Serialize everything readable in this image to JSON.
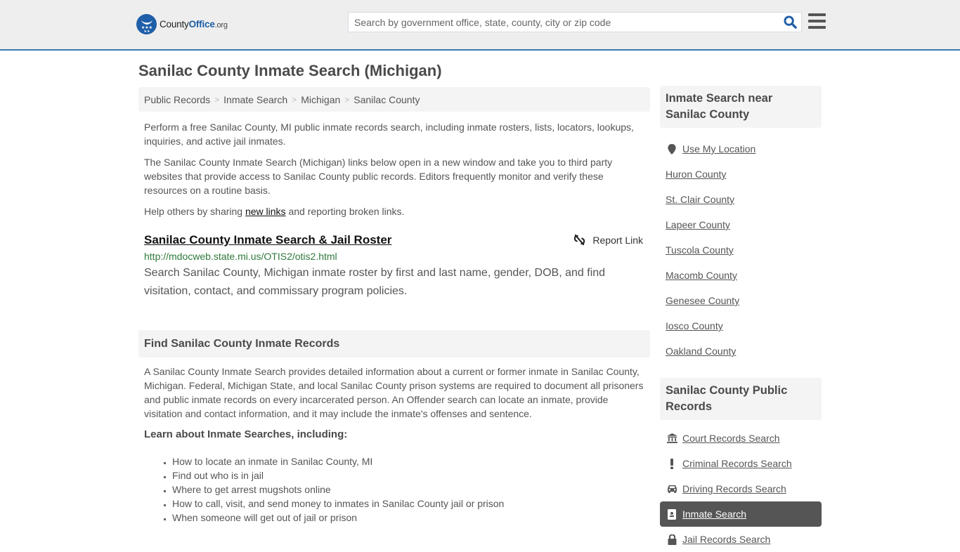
{
  "header": {
    "logo": {
      "part1": "County",
      "part2": "Office",
      "part3": ".org"
    },
    "search": {
      "placeholder": "Search by government office, state, county, city or zip code",
      "value": ""
    },
    "search_icon": "search-icon",
    "menu_icon": "hamburger-menu-icon",
    "accent_color": "#1f5ea8"
  },
  "page": {
    "title": "Sanilac County Inmate Search (Michigan)"
  },
  "breadcrumb": [
    {
      "label": "Public Records"
    },
    {
      "label": "Inmate Search"
    },
    {
      "label": "Michigan"
    },
    {
      "label": "Sanilac County"
    }
  ],
  "intro": {
    "p1": "Perform a free Sanilac County, MI public inmate records search, including inmate rosters, lists, locators, lookups, inquiries, and active jail inmates.",
    "p2": "The Sanilac County Inmate Search (Michigan) links below open in a new window and take you to third party websites that provide access to Sanilac County public records. Editors frequently monitor and verify these resources on a routine basis.",
    "p3_before": "Help others by sharing ",
    "p3_link": "new links",
    "p3_after": " and reporting broken links."
  },
  "result": {
    "title": "Sanilac County Inmate Search & Jail Roster",
    "report_label": "Report Link",
    "url": "http://mdocweb.state.mi.us/OTIS2/otis2.html",
    "description": "Search Sanilac County, Michigan inmate roster by first and last name, gender, DOB, and find visitation, contact, and commissary program policies."
  },
  "find_section": {
    "heading": "Find Sanilac County Inmate Records",
    "body": "A Sanilac County Inmate Search provides detailed information about a current or former inmate in Sanilac County, Michigan. Federal, Michigan State, and local Sanilac County prison systems are required to document all prisoners and public inmate records on every incarcerated person. An Offender search can locate an inmate, provide visitation and contact information, and it may include the inmate's offenses and sentence.",
    "learn_heading": "Learn about Inmate Searches, including:",
    "bullets": [
      "How to locate an inmate in Sanilac County, MI",
      "Find out who is in jail",
      "Where to get arrest mugshots online",
      "How to call, visit, and send money to inmates in Sanilac County jail or prison",
      "When someone will get out of jail or prison"
    ]
  },
  "sidebar": {
    "nearby_heading": "Inmate Search near Sanilac County",
    "use_location": "Use My Location",
    "nearby": [
      "Huron County",
      "St. Clair County",
      "Lapeer County",
      "Tuscola County",
      "Macomb County",
      "Genesee County",
      "Iosco County",
      "Oakland County"
    ],
    "records_heading": "Sanilac County Public Records",
    "records": [
      {
        "label": "Court Records Search",
        "icon": "courthouse-icon",
        "active": false
      },
      {
        "label": "Criminal Records Search",
        "icon": "exclamation-icon",
        "active": false
      },
      {
        "label": "Driving Records Search",
        "icon": "car-icon",
        "active": false
      },
      {
        "label": "Inmate Search",
        "icon": "id-badge-icon",
        "active": true
      },
      {
        "label": "Jail Records Search",
        "icon": "lock-icon",
        "active": false
      }
    ]
  }
}
